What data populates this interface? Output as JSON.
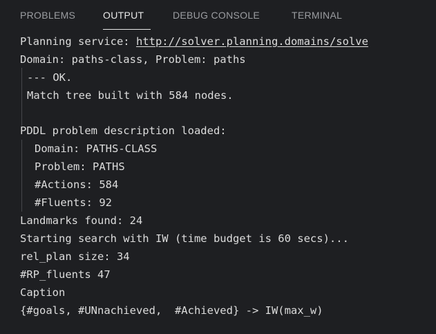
{
  "tabs": [
    {
      "label": "PROBLEMS"
    },
    {
      "label": "OUTPUT"
    },
    {
      "label": "DEBUG CONSOLE"
    },
    {
      "label": "TERMINAL"
    }
  ],
  "active_tab": "OUTPUT",
  "output": {
    "service_label": "Planning service: ",
    "service_url": "http://solver.planning.domains/solve",
    "domain_problem": "Domain: paths-class, Problem: paths",
    "ok": "--- OK.",
    "match_tree": "Match tree built with 584 nodes.",
    "pddl_loaded": "PDDL problem description loaded:",
    "pddl_domain": "Domain: PATHS-CLASS",
    "pddl_problem": "Problem: PATHS",
    "pddl_actions": "#Actions: 584",
    "pddl_fluents": "#Fluents: 92",
    "landmarks": "Landmarks found: 24",
    "starting_search": "Starting search with IW (time budget is 60 secs)...",
    "rel_plan": "rel_plan size: 34",
    "rp_fluents": "#RP_fluents 47",
    "caption": "Caption",
    "goals": "{#goals, #UNnachieved,  #Achieved} -> IW(max_w)"
  },
  "colors": {
    "background": "#1e1f22",
    "text": "#dcdcdc",
    "tab_inactive": "#9b9da1",
    "tab_active": "#e8e8e8",
    "indent_guide": "#45474b"
  }
}
